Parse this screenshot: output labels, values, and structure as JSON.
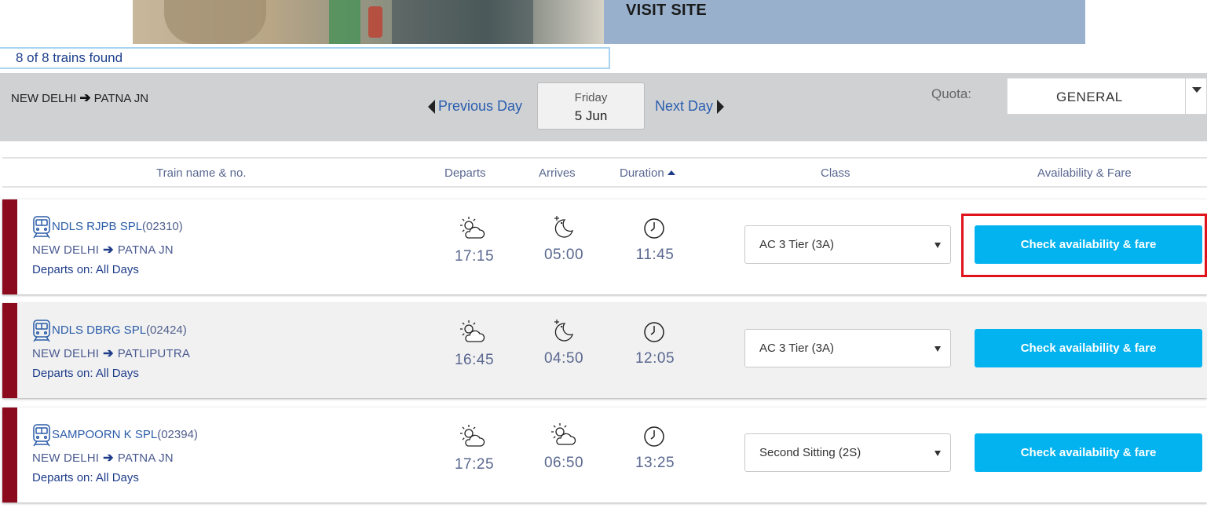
{
  "banner": {
    "cta": "VISIT SITE"
  },
  "results": {
    "count_text": "8 of 8 trains found"
  },
  "search": {
    "origin": "NEW DELHI",
    "destination": "PATNA JN",
    "prev_day": "Previous Day",
    "next_day": "Next Day",
    "day_of_week": "Friday",
    "date": "5 Jun",
    "quota_label": "Quota:",
    "quota_value": "GENERAL"
  },
  "columns": {
    "train": "Train name & no.",
    "departs": "Departs",
    "arrives": "Arrives",
    "duration": "Duration",
    "class": "Class",
    "availability": "Availability & Fare"
  },
  "trains": [
    {
      "name": "NDLS RJPB SPL",
      "number": "(02310)",
      "from": "NEW DELHI",
      "to": "PATNA JN",
      "days": "Departs on: All Days",
      "depart_icon": "partly-cloudy-icon",
      "depart": "17:15",
      "arrive_icon": "moon-icon",
      "arrive": "05:00",
      "duration_icon": "clock-icon",
      "duration": "11:45",
      "class": "AC 3 Tier (3A)",
      "button": "Check availability & fare"
    },
    {
      "name": "NDLS DBRG SPL",
      "number": "(02424)",
      "from": "NEW DELHI",
      "to": "PATLIPUTRA",
      "days": "Departs on: All Days",
      "depart_icon": "partly-cloudy-icon",
      "depart": "16:45",
      "arrive_icon": "moon-icon",
      "arrive": "04:50",
      "duration_icon": "clock-icon",
      "duration": "12:05",
      "class": "AC 3 Tier (3A)",
      "button": "Check availability & fare"
    },
    {
      "name": "SAMPOORN K SPL",
      "number": "(02394)",
      "from": "NEW DELHI",
      "to": "PATNA JN",
      "days": "Departs on: All Days",
      "depart_icon": "partly-cloudy-icon",
      "depart": "17:25",
      "arrive_icon": "partly-cloudy-icon",
      "arrive": "06:50",
      "duration_icon": "clock-icon",
      "duration": "13:25",
      "class": "Second Sitting (2S)",
      "button": "Check availability & fare"
    }
  ],
  "colors": {
    "accent_blue": "#03b3f0",
    "link_blue": "#2a5eb0",
    "stripe_maroon": "#8b0a1e",
    "highlight_red": "#e0121b",
    "search_bar_bg": "#d0d1d3"
  }
}
